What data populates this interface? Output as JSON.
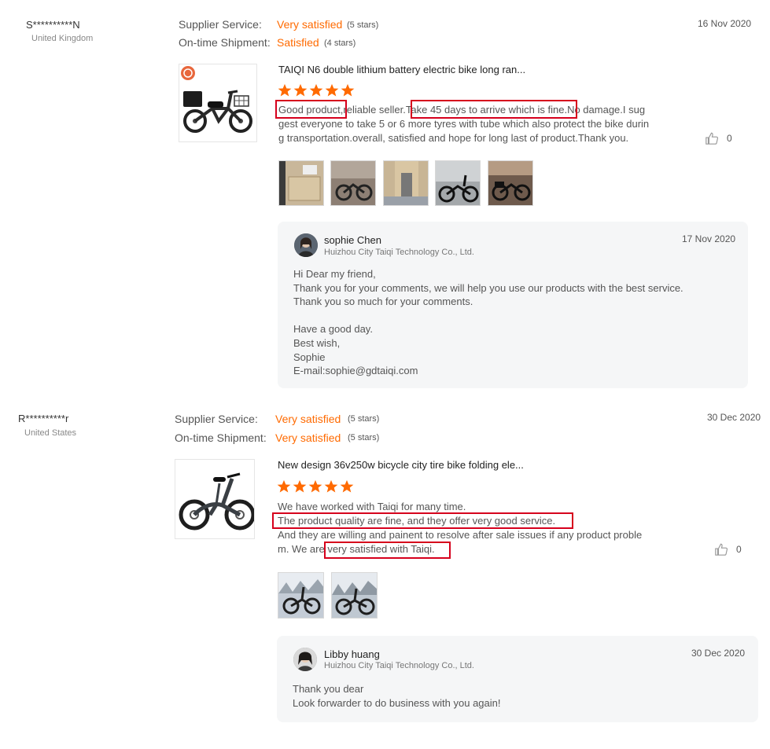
{
  "reviews": [
    {
      "user_name": "S**********N",
      "user_country": "United Kingdom",
      "supplier_service_label": "Supplier Service:",
      "supplier_service_value": "Very satisfied",
      "supplier_service_stars": "(5 stars)",
      "shipment_label": "On-time Shipment:",
      "shipment_value": "Satisfied",
      "shipment_stars": "(4 stars)",
      "date": "16 Nov 2020",
      "product_title": "TAIQI N6 double lithium battery electric bike long ran...",
      "rating": 5,
      "text_lines": [
        "Good product,reliable seller.Take 45 days to arrive which is fine.No damage.I sug",
        "gest everyone to take 5 or 6 more tyres with tube which also protect the bike durin",
        "g transportation.overall, satisfied and hope for long last of product.Thank you."
      ],
      "likes": "0",
      "photo_count": 5,
      "reply": {
        "name": "sophie Chen",
        "company": "Huizhou City Taiqi Technology Co., Ltd.",
        "date": "17 Nov 2020",
        "lines": [
          "Hi Dear my friend,",
          "Thank you for your comments, we will help you use our products with the best service.",
          "Thank you so much for your comments.",
          "",
          "Have a good day.",
          "Best wish,",
          "Sophie",
          "E-mail:sophie@gdtaiqi.com"
        ]
      }
    },
    {
      "user_name": "R**********r",
      "user_country": "United States",
      "supplier_service_label": "Supplier Service:",
      "supplier_service_value": "Very satisfied",
      "supplier_service_stars": "(5 stars)",
      "shipment_label": "On-time Shipment:",
      "shipment_value": "Very satisfied",
      "shipment_stars": "(5 stars)",
      "date": "30 Dec 2020",
      "product_title": "New design 36v250w bicycle city tire bike folding ele...",
      "rating": 5,
      "text_lines": [
        "We have worked with Taiqi for many time.",
        "The product quality are fine, and they offer very good service.",
        "And they are willing and painent to resolve after sale issues if any product proble",
        "m. We are very satisfied with Taiqi."
      ],
      "likes": "0",
      "photo_count": 2,
      "reply": {
        "name": "Libby huang",
        "company": "Huizhou City Taiqi Technology Co., Ltd.",
        "date": "30 Dec 2020",
        "lines": [
          "Thank you dear",
          "Look forwarder to do business with you again!"
        ]
      }
    }
  ],
  "colors": {
    "accent": "#ff6a00",
    "highlight_border": "#d6001c",
    "reply_bg": "#f5f6f7"
  },
  "icons": {
    "like": "thumbs-up-icon",
    "star": "star-icon"
  }
}
